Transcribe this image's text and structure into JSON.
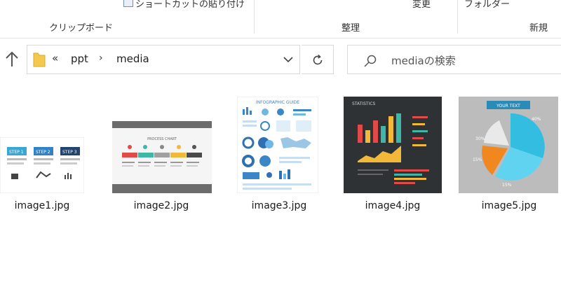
{
  "ribbon": {
    "top_cut_label": "ショートカットの貼り付け",
    "change_label": "変更",
    "folder_label": "フォルダー",
    "groups": {
      "clipboard": "クリップボード",
      "organize": "整理",
      "new": "新規"
    }
  },
  "address": {
    "overflow": "«",
    "crumbs": [
      "ppt",
      "media"
    ],
    "separator": "›"
  },
  "search": {
    "placeholder": "mediaの検索"
  },
  "files": [
    {
      "name": "image1.jpg"
    },
    {
      "name": "image2.jpg"
    },
    {
      "name": "image3.jpg"
    },
    {
      "name": "image4.jpg"
    },
    {
      "name": "image5.jpg"
    }
  ],
  "thumbnails": {
    "image1": {
      "steps": [
        "STEP 1",
        "STEP 2",
        "STEP 3"
      ]
    },
    "image2": {
      "title": "PROCESS CHART"
    },
    "image3": {
      "title": "INFOGRAPHIC GUIDE"
    },
    "image4": {
      "title": "STATISTICS"
    },
    "image5": {
      "title": "YOUR TEXT",
      "labels": [
        "40%",
        "30%",
        "15%",
        "15%"
      ]
    }
  },
  "colors": {
    "accent_blue": "#0078d7",
    "folder_yellow": "#f3c84c"
  }
}
